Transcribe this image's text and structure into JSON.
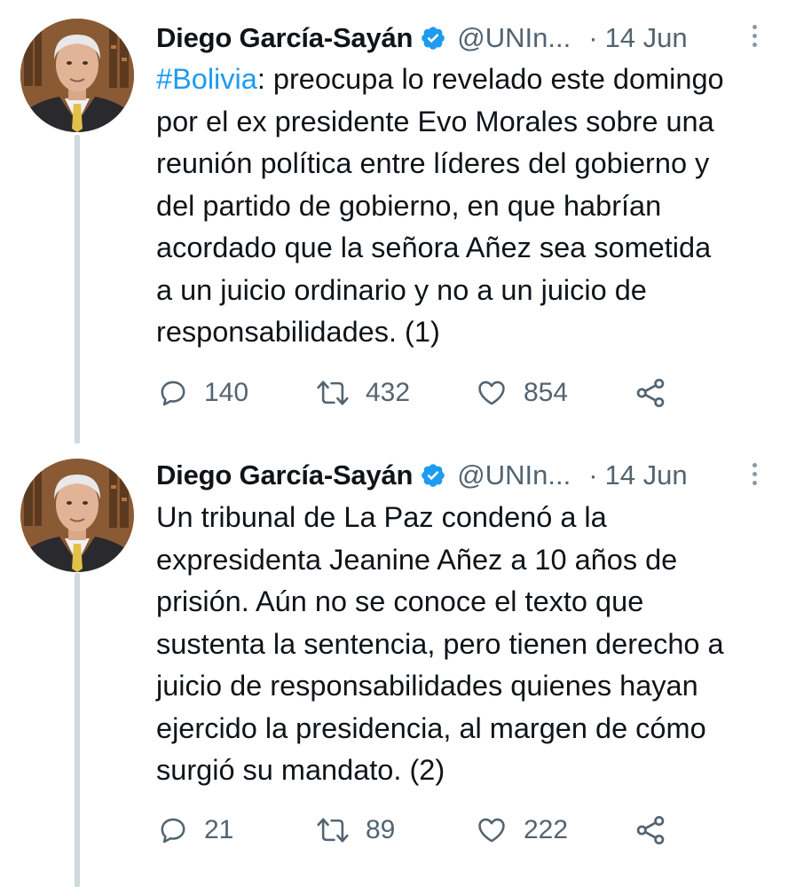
{
  "tweets": [
    {
      "author": "Diego García-Sayán",
      "handle": "@UNIn...",
      "separator": "·",
      "date": "14 Jun",
      "hashtag": "#Bolivia",
      "lines": [
        ": preocupa lo revelado este domingo",
        "por el ex presidente Evo Morales sobre una",
        "reunión política entre líderes del gobierno y",
        "del partido de gobierno, en que habrían",
        "acordado que la señora Añez sea sometida",
        "a un juicio ordinario y no a un juicio de",
        "responsabilidades. (1)"
      ],
      "replies": "140",
      "retweets": "432",
      "likes": "854"
    },
    {
      "author": "Diego García-Sayán",
      "handle": "@UNIn...",
      "separator": "·",
      "date": "14 Jun",
      "lines": [
        "Un tribunal de La Paz condenó a la",
        "expresidenta Jeanine Añez a 10 años de",
        "prisión. Aún no se conoce el texto que",
        "sustenta la sentencia, pero tienen derecho a",
        "juicio de responsabilidades quienes hayan",
        "ejercido la presidencia, al margen de cómo",
        "surgió su mandato. (2)"
      ],
      "replies": "21",
      "retweets": "89",
      "likes": "222"
    }
  ],
  "icons": {
    "verified": "verified-badge-icon",
    "more": "more-vertical-icon",
    "reply": "reply-icon",
    "retweet": "retweet-icon",
    "like": "heart-icon",
    "share": "share-icon"
  },
  "colors": {
    "text": "#0f1419",
    "muted": "#536471",
    "link": "#1d9bf0",
    "verified": "#1d9bf0",
    "thread_line": "#cfd9de"
  }
}
